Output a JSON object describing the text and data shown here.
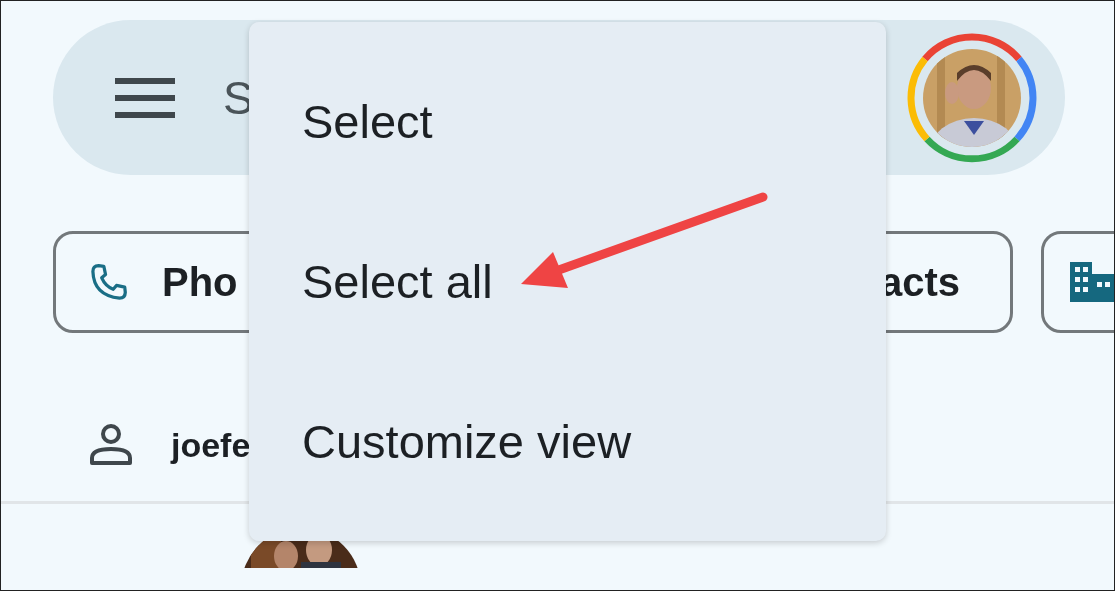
{
  "search_bar": {
    "placeholder": "S"
  },
  "filter_chips": [
    {
      "kind": "phone",
      "label": "Pho"
    },
    {
      "kind": "plain",
      "label": "acts"
    },
    {
      "kind": "building"
    }
  ],
  "account": {
    "label": "joefe"
  },
  "menu": {
    "items": [
      {
        "label": "Select"
      },
      {
        "label": "Select all"
      },
      {
        "label": "Customize view"
      }
    ]
  }
}
